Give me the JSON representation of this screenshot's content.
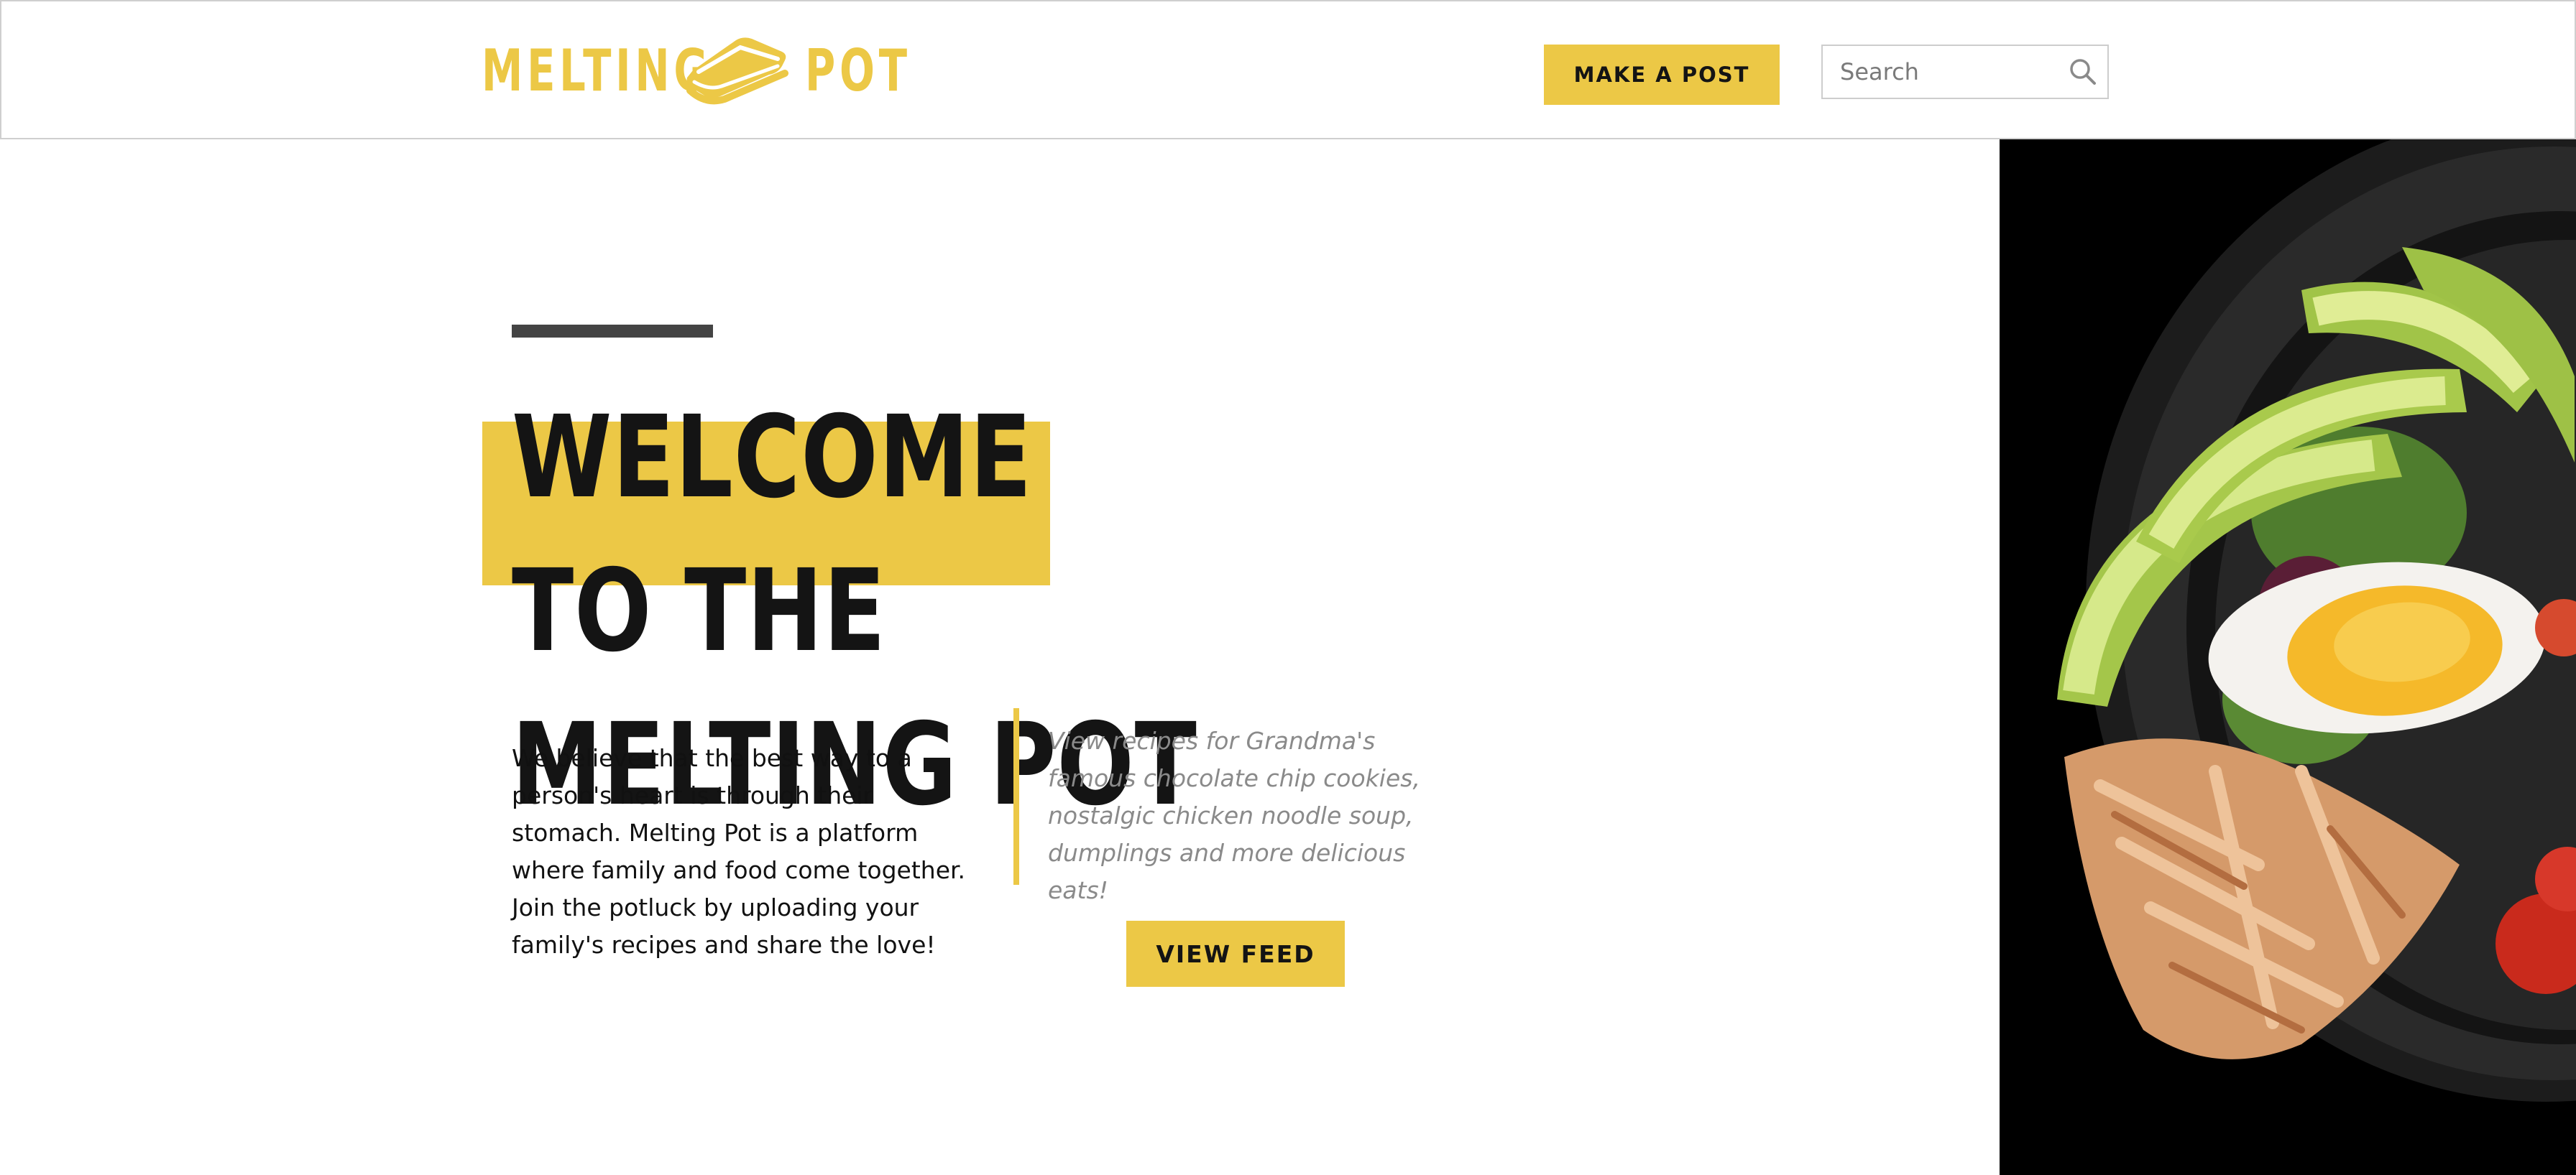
{
  "header": {
    "logo": {
      "word1": "MELTING",
      "word2": "POT",
      "icon": "sandwich-icon"
    },
    "make_post_label": "MAKE A POST",
    "search": {
      "placeholder": "Search",
      "value": "",
      "icon": "search-icon"
    }
  },
  "hero": {
    "title_line1": "WELCOME TO THE",
    "title_line2": "MELTING POT",
    "intro": "We believe that the best way to a person's heart is through their stomach. Melting Pot is a platform where family and food come together. Join the potluck by uploading your family's recipes and share the love!",
    "quote": "View recipes for Grandma's famous chocolate chip cookies, nostalgic chicken noodle soup, dumplings and more delicious eats!",
    "view_feed_label": "VIEW FEED",
    "image": "salad-bowl-photo"
  },
  "colors": {
    "accent": "#ecc846",
    "text": "#141414",
    "muted": "#8a8a8a",
    "divider": "#444444",
    "border": "#cfcfcf"
  }
}
